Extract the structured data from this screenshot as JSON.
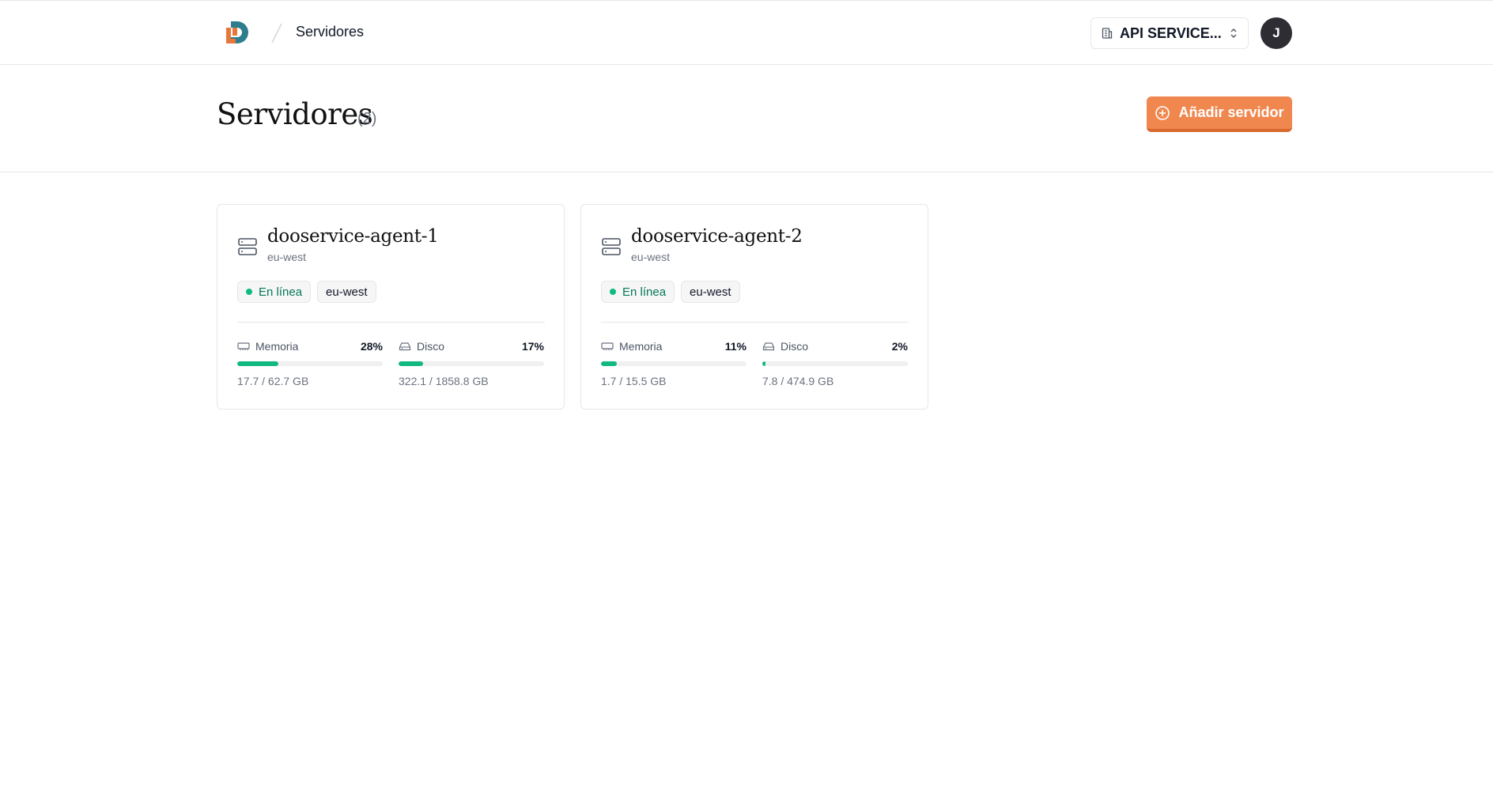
{
  "header": {
    "breadcrumb": "Servidores",
    "org_select": "API SERVICE...",
    "avatar_initial": "J"
  },
  "page": {
    "title": "Servidores",
    "count": "(2)",
    "add_button": "Añadir servidor"
  },
  "colors": {
    "accent": "#f0874f",
    "logo_orange": "#e8773a",
    "logo_teal": "#2e7d8c",
    "online": "#10b981"
  },
  "servers": [
    {
      "name": "dooservice-agent-1",
      "region": "eu-west",
      "status": "En línea",
      "tag": "eu-west",
      "memory": {
        "label": "Memoria",
        "percent": "28%",
        "value": 0.28,
        "usage": "17.7 / 62.7 GB"
      },
      "disk": {
        "label": "Disco",
        "percent": "17%",
        "value": 0.17,
        "usage": "322.1 / 1858.8 GB"
      }
    },
    {
      "name": "dooservice-agent-2",
      "region": "eu-west",
      "status": "En línea",
      "tag": "eu-west",
      "memory": {
        "label": "Memoria",
        "percent": "11%",
        "value": 0.11,
        "usage": "1.7 / 15.5 GB"
      },
      "disk": {
        "label": "Disco",
        "percent": "2%",
        "value": 0.02,
        "usage": "7.8 / 474.9 GB"
      }
    }
  ]
}
